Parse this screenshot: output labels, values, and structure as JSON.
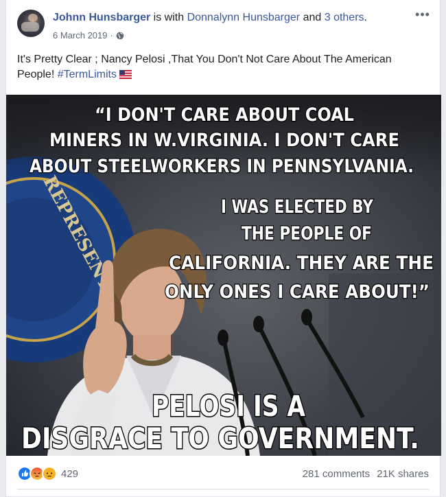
{
  "post": {
    "author": "Johnn Hunsbarger",
    "with_text": " is with ",
    "tagged": "Donnalynn Hunsbarger",
    "and_text": " and ",
    "others": "3 others",
    "period": ".",
    "date": "6 March 2019",
    "separator": "·",
    "privacy_icon": "globe-icon",
    "more_icon": "more-options-icon",
    "text": "It's Pretty Clear ; Nancy Pelosi ,That You Don't Not Care About The American People! ",
    "hashtag": "#TermLimits",
    "emoji": "us-flag-emoji"
  },
  "image": {
    "quote_lines": [
      "“I DON'T CARE ABOUT COAL",
      "MINERS IN W.VIRGINIA. I DON'T CARE",
      "ABOUT STEELWORKERS IN PENNSYLVANIA."
    ],
    "quote2_lines": [
      "I WAS ELECTED BY",
      "THE PEOPLE OF",
      "CALIFORNIA. THEY ARE THE",
      "ONLY ONES  I CARE ABOUT!”"
    ],
    "caption_lines": [
      "PELOSI IS A",
      "DISGRACE TO GOVERNMENT."
    ],
    "seal_text": "REPRESENT"
  },
  "footer": {
    "reactions": [
      "like",
      "angry",
      "sad"
    ],
    "reaction_count": "429",
    "comments": "281 comments",
    "shares": "21K shares"
  },
  "colors": {
    "link": "#385898",
    "like": "#1877f2",
    "angry": "#f0553a",
    "sad": "#f7b125"
  }
}
